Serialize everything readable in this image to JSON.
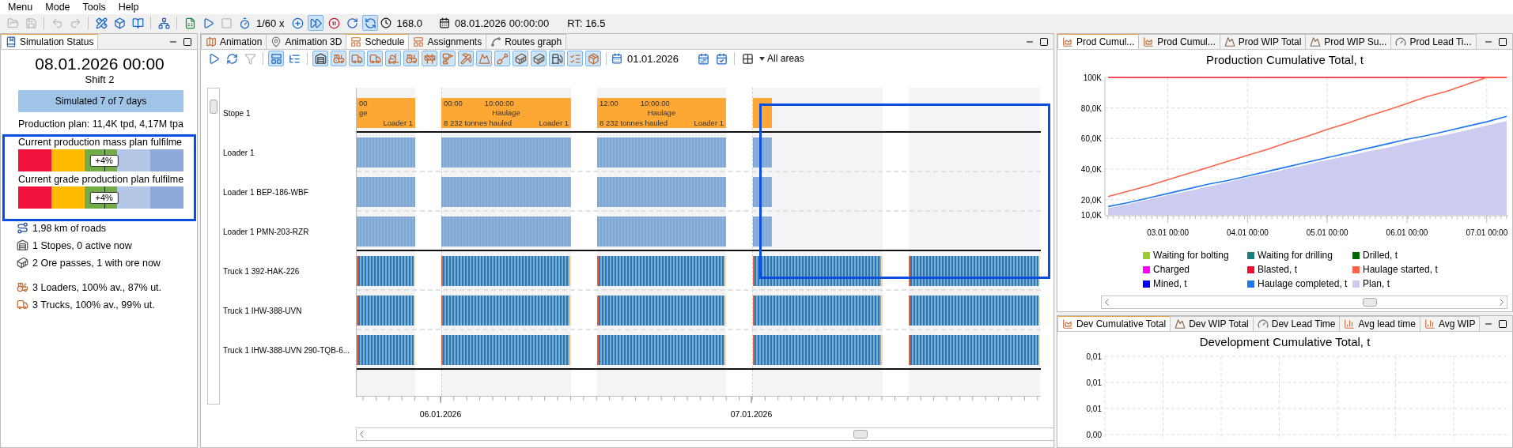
{
  "menu": [
    {
      "label": "Menu"
    },
    {
      "label": "Mode"
    },
    {
      "label": "Tools"
    },
    {
      "label": "Help"
    }
  ],
  "toolbar": [
    {
      "kind": "button",
      "disabled": true
    },
    {
      "kind": "button",
      "disabled": true
    },
    {
      "kind": "separator"
    },
    {
      "kind": "button",
      "disabled": true
    },
    {
      "kind": "button",
      "disabled": true
    },
    {
      "kind": "separator"
    },
    {
      "kind": "button",
      "disabled": false
    },
    {
      "kind": "button",
      "disabled": false
    },
    {
      "kind": "button",
      "disabled": false
    },
    {
      "kind": "separator"
    },
    {
      "kind": "button",
      "disabled": false
    },
    {
      "kind": "separator"
    },
    {
      "kind": "button",
      "disabled": false
    },
    {
      "kind": "button",
      "disabled": false
    },
    {
      "kind": "button",
      "disabled": true
    },
    {
      "kind": "button",
      "disabled": false
    },
    {
      "kind": "label",
      "text": "1/60 x"
    },
    {
      "kind": "toggle",
      "selected": false
    },
    {
      "kind": "toggle",
      "selected": true
    },
    {
      "kind": "button",
      "disabled": false
    },
    {
      "kind": "button",
      "disabled": false
    },
    {
      "kind": "toggle",
      "selected": true
    },
    {
      "kind": "readout",
      "text": "168.0"
    },
    {
      "kind": "readout",
      "text": "08.01.2026 00:00:00"
    },
    {
      "kind": "label",
      "text": "RT: 16.5"
    }
  ],
  "status_panel": {
    "tab": "Simulation Status",
    "date": "08.01.2026 00:00",
    "shift": "Shift 2",
    "progress": {
      "label": "Simulated 7 of 7 days",
      "level": 1
    },
    "plan": "Production plan: 11,4K tpd, 4,17M tpa",
    "gauges": [
      {
        "title": "Current production mass plan fulfilme",
        "badge": "+4%",
        "level": 0.52
      },
      {
        "title": "Current grade production plan fulfilme",
        "badge": "+4%",
        "level": 0.52
      }
    ],
    "stats": [
      {
        "kind": "roads",
        "text": "1,98 km of roads"
      },
      {
        "kind": "stopes",
        "text": "1 Stopes, 0 active now"
      },
      {
        "kind": "ore_passes",
        "text": "2 Ore passes, 1 with ore now"
      },
      {
        "kind": "loaders",
        "text": "3 Loaders, 100% av., 87% ut."
      },
      {
        "kind": "trucks",
        "text": "3 Trucks, 100% av., 99% ut."
      }
    ]
  },
  "schedule_panel": {
    "tabs": [
      {
        "label": "Animation",
        "kind": "map",
        "selected": false
      },
      {
        "label": "Animation 3D",
        "kind": "pin",
        "selected": false
      },
      {
        "label": "Schedule",
        "kind": "gantt",
        "selected": true
      },
      {
        "label": "Assignments",
        "kind": "gantt",
        "selected": false
      },
      {
        "label": "Routes graph",
        "kind": "graph",
        "selected": false
      }
    ],
    "toolbar": [
      {
        "kind": "button",
        "disabled": false
      },
      {
        "kind": "button",
        "disabled": false
      },
      {
        "kind": "button",
        "disabled": true
      },
      {
        "kind": "separator"
      },
      {
        "kind": "toggle",
        "selected": true
      },
      {
        "kind": "toggle",
        "selected": false
      },
      {
        "kind": "separator"
      },
      {
        "kind": "toggle",
        "selected": true
      },
      {
        "kind": "toggle",
        "selected": true
      },
      {
        "kind": "toggle",
        "selected": true
      },
      {
        "kind": "toggle",
        "selected": true
      },
      {
        "kind": "toggle",
        "selected": true
      },
      {
        "kind": "toggle",
        "selected": true
      },
      {
        "kind": "toggle",
        "selected": true
      },
      {
        "kind": "toggle",
        "selected": true
      },
      {
        "kind": "toggle",
        "selected": true
      },
      {
        "kind": "toggle",
        "selected": true
      },
      {
        "kind": "toggle",
        "selected": true
      },
      {
        "kind": "toggle",
        "selected": true
      },
      {
        "kind": "toggle",
        "selected": true
      },
      {
        "kind": "toggle",
        "selected": true
      },
      {
        "kind": "toggle",
        "selected": true
      },
      {
        "kind": "toggle",
        "selected": true
      },
      {
        "kind": "separator"
      },
      {
        "kind": "readout",
        "text": "01.01.2026"
      },
      {
        "kind": "button",
        "disabled": false
      },
      {
        "kind": "button",
        "disabled": false
      },
      {
        "kind": "separator"
      },
      {
        "kind": "button",
        "disabled": false
      },
      {
        "kind": "dropdown",
        "text": "All areas"
      }
    ],
    "rows": [
      {
        "label": "Stope 1",
        "kind": "stope",
        "blocks": [
          {
            "time": "00",
            "activity": "ge",
            "equipment": "Loader 1",
            "cut_left": true
          },
          {
            "time": "00:00",
            "duration": "10:00:00",
            "activity": "Haulage",
            "hauled": "8 232 tonnes hauled",
            "equipment": "Loader 1",
            "cut_left": false
          },
          {
            "time": "12:00",
            "duration": "10:00:00",
            "activity": "Haulage",
            "hauled": "8 232 tonnes hauled",
            "equipment": "Loader 1",
            "cut_left": false
          }
        ]
      },
      {
        "label": "Loader 1",
        "kind": "loader"
      },
      {
        "label": "Loader 1 BEP-186-WBF",
        "kind": "loader"
      },
      {
        "label": "Loader 1 PMN-203-RZR",
        "kind": "loader"
      },
      {
        "label": "Truck 1 392-HAK-226",
        "kind": "truck"
      },
      {
        "label": "Truck 1 IHW-388-UVN",
        "kind": "truck"
      },
      {
        "label": "Truck 1 IHW-388-UVN 290-TQB-6...",
        "kind": "truck"
      }
    ],
    "dates": [
      "06.01.2026",
      "07.01.2026"
    ]
  },
  "production_panel": {
    "tabs": [
      {
        "label": "Prod Cumul...",
        "kind": "area",
        "selected": true
      },
      {
        "label": "Prod Cumul...",
        "kind": "area",
        "selected": false
      },
      {
        "label": "Prod WIP Total",
        "kind": "wip",
        "selected": false
      },
      {
        "label": "Prod WIP Su...",
        "kind": "wip",
        "selected": false
      },
      {
        "label": "Prod Lead Ti...",
        "kind": "lead",
        "selected": false
      }
    ],
    "chart_data": {
      "type": "line",
      "title": "Production Cumulative Total, t",
      "grid": true,
      "categories": [
        null,
        null,
        null,
        "03.01 00:00",
        null,
        null,
        null,
        "04.01 00:00",
        null,
        null,
        null,
        "05.01 00:00",
        null,
        null,
        null,
        "06.01 00:00",
        null,
        null,
        null,
        "07.01 00:00",
        null
      ],
      "series": [
        {
          "name": "Waiting for bolting",
          "color": "#99cc33",
          "values": [
            null,
            null,
            null,
            null,
            null,
            null,
            null,
            null,
            null,
            null,
            null,
            null,
            null,
            null,
            null,
            null,
            null,
            null,
            null,
            null,
            null
          ]
        },
        {
          "name": "Waiting for drilling",
          "color": "#168080",
          "values": [
            null,
            null,
            null,
            null,
            null,
            null,
            null,
            null,
            null,
            null,
            null,
            null,
            null,
            null,
            null,
            null,
            null,
            null,
            null,
            null,
            null
          ]
        },
        {
          "name": "Drilled, t",
          "color": "#006400",
          "values": [
            null,
            null,
            null,
            null,
            null,
            null,
            null,
            null,
            null,
            null,
            null,
            null,
            null,
            null,
            null,
            null,
            null,
            null,
            null,
            null,
            null
          ]
        },
        {
          "name": "Charged",
          "color": "#ff00ff",
          "values": [
            null,
            null,
            null,
            null,
            null,
            null,
            null,
            null,
            null,
            null,
            null,
            null,
            null,
            null,
            null,
            null,
            null,
            null,
            null,
            null,
            null
          ]
        },
        {
          "name": "Blasted, t",
          "color": "#f0102e",
          "values": [
            100000,
            100000,
            100000,
            100000,
            100000,
            100000,
            100000,
            100000,
            100000,
            100000,
            100000,
            100000,
            100000,
            100000,
            100000,
            100000,
            100000,
            100000,
            100000,
            100000,
            100000
          ]
        },
        {
          "name": "Haulage started, t",
          "color": "#ff6347",
          "values": [
            22000,
            25500,
            29000,
            33000,
            37000,
            41000,
            45000,
            49000,
            53000,
            57500,
            61500,
            66000,
            70000,
            74500,
            78500,
            83000,
            87500,
            91000,
            95500,
            100000,
            100000
          ]
        },
        {
          "name": "Mined, t",
          "color": "#0000ff",
          "values": [
            null,
            null,
            null,
            null,
            null,
            null,
            null,
            null,
            null,
            null,
            null,
            null,
            null,
            null,
            null,
            null,
            null,
            null,
            null,
            null,
            null
          ]
        },
        {
          "name": "Haulage completed, t",
          "color": "#1e78f0",
          "values": [
            15500,
            18000,
            21000,
            24000,
            27000,
            30000,
            32500,
            35500,
            38500,
            41500,
            44500,
            47500,
            50500,
            53500,
            56500,
            59500,
            62000,
            65000,
            68000,
            71000,
            74500
          ]
        },
        {
          "name": "Plan, t",
          "color": "#cccbf0",
          "type": "area",
          "values": [
            14500,
            17000,
            20000,
            23000,
            25500,
            28500,
            31500,
            34500,
            37000,
            40000,
            43000,
            46000,
            48500,
            51500,
            54000,
            57000,
            60000,
            62500,
            65500,
            68500,
            71500
          ]
        }
      ],
      "ylim": [
        10000,
        100000
      ],
      "yticks": [
        {
          "value": 10000,
          "label": "10,0K"
        },
        {
          "value": 20000,
          "label": "20,0K"
        },
        {
          "value": 40000,
          "label": "40,0K"
        },
        {
          "value": 60000,
          "label": "60,0K"
        },
        {
          "value": 80000,
          "label": "80,0K"
        },
        {
          "value": 100000,
          "label": "100K"
        }
      ]
    }
  },
  "development_panel": {
    "tabs": [
      {
        "label": "Dev Cumulative Total",
        "kind": "area",
        "selected": true
      },
      {
        "label": "Dev WIP Total",
        "kind": "wip",
        "selected": false
      },
      {
        "label": "Dev Lead Time",
        "kind": "lead",
        "selected": false
      },
      {
        "label": "Avg lead time",
        "kind": "bar",
        "selected": false
      },
      {
        "label": "Avg WIP",
        "kind": "bar",
        "selected": false
      }
    ],
    "title": "Development Cumulative Total, t",
    "y_tick_labels": [
      "0,01",
      "0,01",
      "0,01",
      "0,00"
    ]
  }
}
